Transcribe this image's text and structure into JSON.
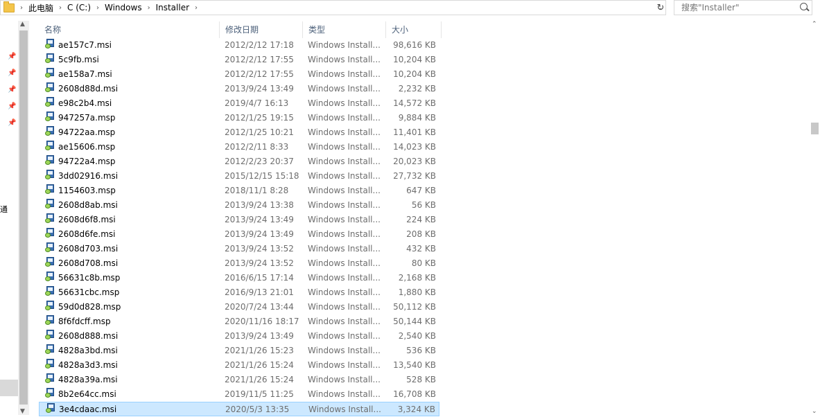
{
  "address": {
    "breadcrumbs": [
      "此电脑",
      "C (C:)",
      "Windows",
      "Installer"
    ],
    "dropdown_glyph": "⌄",
    "refresh_glyph": "↻"
  },
  "search": {
    "placeholder": "搜索\"Installer\""
  },
  "nav": {
    "partial_label": "通"
  },
  "columns": {
    "name": "名称",
    "date": "修改日期",
    "type": "类型",
    "size": "大小"
  },
  "files": [
    {
      "name": "ae157c7.msi",
      "date": "2012/2/12 17:18",
      "type": "Windows Install...",
      "size": "98,616 KB"
    },
    {
      "name": "5c9fb.msi",
      "date": "2012/2/12 17:55",
      "type": "Windows Install...",
      "size": "10,204 KB"
    },
    {
      "name": "ae158a7.msi",
      "date": "2012/2/12 17:55",
      "type": "Windows Install...",
      "size": "10,204 KB"
    },
    {
      "name": "2608d88d.msi",
      "date": "2013/9/24 13:49",
      "type": "Windows Install...",
      "size": "2,232 KB"
    },
    {
      "name": "e98c2b4.msi",
      "date": "2019/4/7 16:13",
      "type": "Windows Install...",
      "size": "14,572 KB"
    },
    {
      "name": "947257a.msp",
      "date": "2012/1/25 19:15",
      "type": "Windows Install...",
      "size": "9,884 KB"
    },
    {
      "name": "94722aa.msp",
      "date": "2012/1/25 10:21",
      "type": "Windows Install...",
      "size": "11,401 KB"
    },
    {
      "name": "ae15606.msp",
      "date": "2012/2/11 8:33",
      "type": "Windows Install...",
      "size": "14,023 KB"
    },
    {
      "name": "94722a4.msp",
      "date": "2012/2/23 20:37",
      "type": "Windows Install...",
      "size": "20,023 KB"
    },
    {
      "name": "3dd02916.msi",
      "date": "2015/12/15 15:18",
      "type": "Windows Install...",
      "size": "27,732 KB"
    },
    {
      "name": "1154603.msp",
      "date": "2018/11/1 8:28",
      "type": "Windows Install...",
      "size": "647 KB"
    },
    {
      "name": "2608d8ab.msi",
      "date": "2013/9/24 13:38",
      "type": "Windows Install...",
      "size": "56 KB"
    },
    {
      "name": "2608d6f8.msi",
      "date": "2013/9/24 13:49",
      "type": "Windows Install...",
      "size": "224 KB"
    },
    {
      "name": "2608d6fe.msi",
      "date": "2013/9/24 13:49",
      "type": "Windows Install...",
      "size": "208 KB"
    },
    {
      "name": "2608d703.msi",
      "date": "2013/9/24 13:52",
      "type": "Windows Install...",
      "size": "432 KB"
    },
    {
      "name": "2608d708.msi",
      "date": "2013/9/24 13:52",
      "type": "Windows Install...",
      "size": "80 KB"
    },
    {
      "name": "56631c8b.msp",
      "date": "2016/6/15 17:14",
      "type": "Windows Install...",
      "size": "2,168 KB"
    },
    {
      "name": "56631cbc.msp",
      "date": "2016/9/13 21:01",
      "type": "Windows Install...",
      "size": "1,880 KB"
    },
    {
      "name": "59d0d828.msp",
      "date": "2020/7/24 13:44",
      "type": "Windows Install...",
      "size": "50,112 KB"
    },
    {
      "name": "8f6fdcff.msp",
      "date": "2020/11/16 18:17",
      "type": "Windows Install...",
      "size": "50,144 KB"
    },
    {
      "name": "2608d888.msi",
      "date": "2013/9/24 13:49",
      "type": "Windows Install...",
      "size": "2,540 KB"
    },
    {
      "name": "4828a3bd.msi",
      "date": "2021/1/26 15:23",
      "type": "Windows Install...",
      "size": "536 KB"
    },
    {
      "name": "4828a3d3.msi",
      "date": "2021/1/26 15:24",
      "type": "Windows Install...",
      "size": "13,540 KB"
    },
    {
      "name": "4828a39a.msi",
      "date": "2021/1/26 15:24",
      "type": "Windows Install...",
      "size": "528 KB"
    },
    {
      "name": "8b2e64cc.msi",
      "date": "2019/11/5 11:25",
      "type": "Windows Install...",
      "size": "16,708 KB"
    },
    {
      "name": "3e4cdaac.msi",
      "date": "2020/5/3 13:35",
      "type": "Windows Install...",
      "size": "3,324 KB",
      "selected": true
    }
  ],
  "colors": {
    "selection_bg": "#cce8ff",
    "selection_border": "#99d1ff",
    "header_text": "#4c607a"
  }
}
